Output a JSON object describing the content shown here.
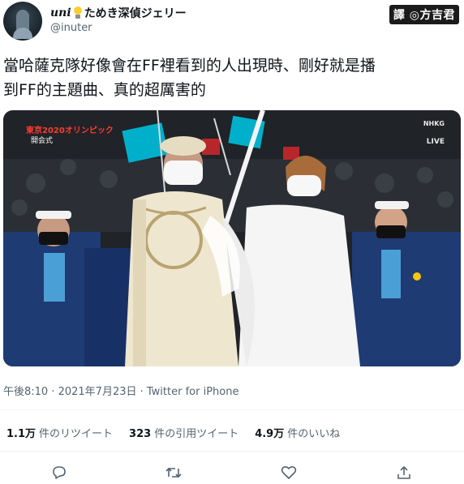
{
  "author": {
    "display_name_a": "uni",
    "display_name_b": "ためき深偵ジェリー",
    "handle": "@inuter",
    "avatar_icon": "avatar-image"
  },
  "watermark": "譯 ◎方吉君",
  "tweet": {
    "line1": "當哈薩克隊好像會在FF裡看到的人出現時、剛好就是播",
    "line2": "到FF的主題曲、真的超厲害的"
  },
  "media": {
    "overlay_top_left": "東京2020オリンピック",
    "overlay_top_left_sub": "開会式",
    "overlay_top_right": "NHKG",
    "overlay_live": "LIVE"
  },
  "timestamp": "午後8:10 · 2021年7月23日 · Twitter for iPhone",
  "stats": {
    "retweets_num": "1.1万",
    "retweets_label": "件のリツイート",
    "quotes_num": "323",
    "quotes_label": "件の引用ツイート",
    "likes_num": "4.9万",
    "likes_label": "件のいいね"
  },
  "actions": {
    "reply": "reply-icon",
    "retweet": "retweet-icon",
    "like": "heart-icon",
    "share": "share-icon"
  },
  "colors": {
    "text": "#0f1419",
    "secondary": "#536471",
    "divider": "#eff3f4",
    "kazakh_blue": "#00afca",
    "kazakh_gold": "#fec50c"
  }
}
